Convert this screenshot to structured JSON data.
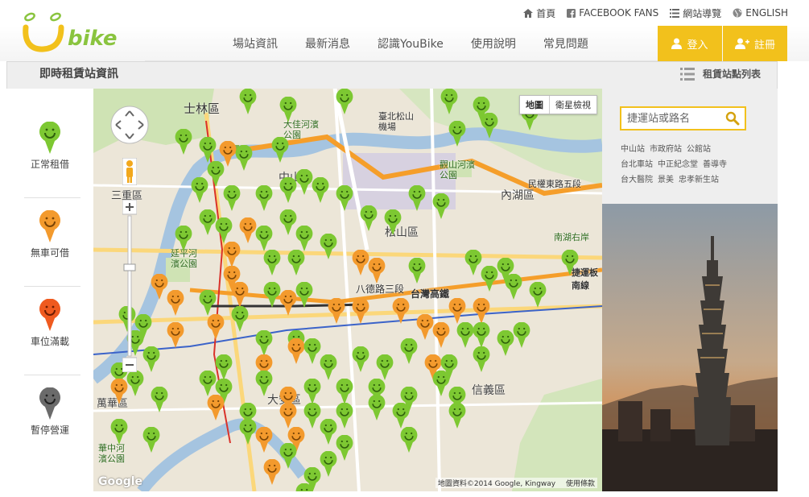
{
  "header": {
    "logo_text": "bike",
    "util_links": [
      {
        "label": "首頁",
        "icon": "home-icon"
      },
      {
        "label": "FACEBOOK FANS",
        "icon": "facebook-icon"
      },
      {
        "label": "網站導覽",
        "icon": "list-icon"
      },
      {
        "label": "ENGLISH",
        "icon": "globe-icon"
      }
    ],
    "nav": [
      "場站資訊",
      "最新消息",
      "認識YouBike",
      "使用說明",
      "常見問題"
    ],
    "login_label": "登入",
    "register_label": "註冊"
  },
  "page": {
    "title": "即時租賃站資訊",
    "list_link": "租賃站點列表"
  },
  "legend": [
    {
      "label": "正常租借",
      "color": "#7dc832"
    },
    {
      "label": "無車可借",
      "color": "#f39a2d"
    },
    {
      "label": "車位滿載",
      "color": "#ef5a1f"
    },
    {
      "label": "暫停營運",
      "color": "#6b6b6b"
    }
  ],
  "map": {
    "type_buttons": [
      "地圖",
      "衛星檢視"
    ],
    "copyright": "地圖資料©2014 Google, Kingway",
    "terms": "使用條款",
    "google": "Google",
    "labels": [
      "士林區",
      "大佳河濱公園",
      "臺北松山機場",
      "觀山河濱公園",
      "內湖區",
      "松山區",
      "中山區",
      "三重區",
      "延平河濱公園",
      "八德路三段",
      "台灣高鐵",
      "信義區",
      "大安區",
      "萬華區",
      "華中河濱公園",
      "民權東路五段",
      "南湖右岸",
      "捷運板南線"
    ]
  },
  "side": {
    "search_placeholder": "捷運站或路名",
    "quick_rows": [
      [
        "中山站",
        "市政府站",
        "公館站"
      ],
      [
        "台北車站",
        "中正紀念堂",
        "善導寺"
      ],
      [
        "台大醫院",
        "景美",
        "忠孝新生站"
      ]
    ]
  },
  "colors": {
    "accent": "#f2c11c",
    "available": "#7dc832",
    "empty": "#f39a2d",
    "full": "#ef5a1f",
    "closed": "#6b6b6b"
  }
}
